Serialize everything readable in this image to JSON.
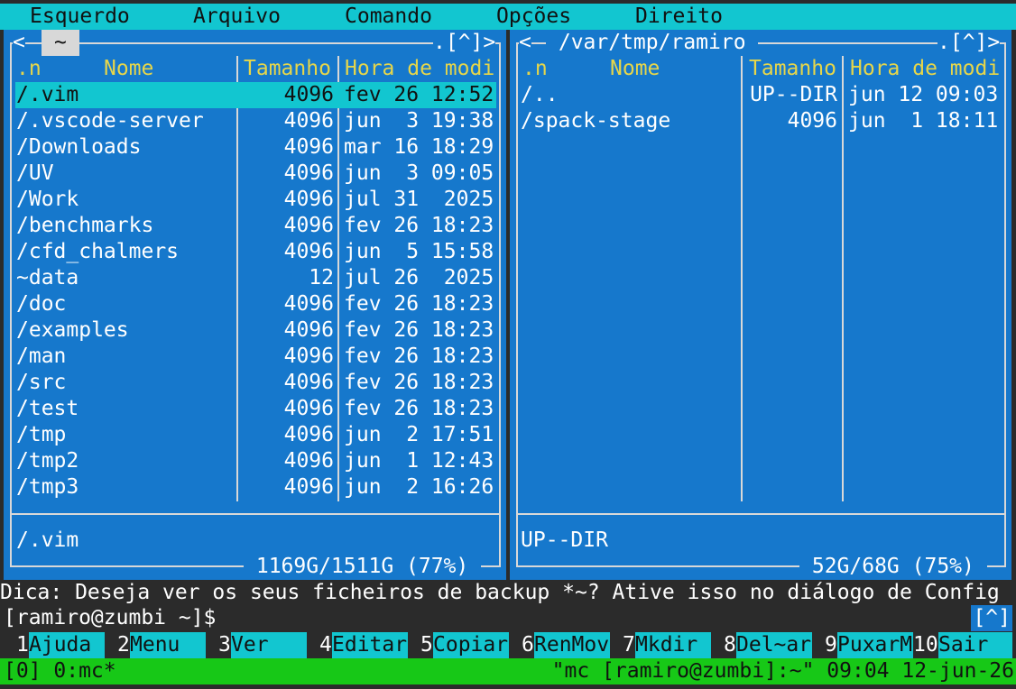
{
  "menubar": {
    "items": [
      "Esquerdo",
      "Arquivo",
      "Comando",
      "Opções",
      "Direito"
    ]
  },
  "left_panel": {
    "path": "~",
    "corner_left": "<",
    "corner_right": ".[^]>",
    "headers": {
      "name_sort": ".n",
      "name": "Nome",
      "size": "Tamanho",
      "time": "Hora de modi"
    },
    "rows": [
      {
        "name": "/.vim",
        "size": "4096",
        "time": "fev 26 12:52",
        "selected": true
      },
      {
        "name": "/.vscode-server",
        "size": "4096",
        "time": "jun  3 19:38"
      },
      {
        "name": "/Downloads",
        "size": "4096",
        "time": "mar 16 18:29"
      },
      {
        "name": "/UV",
        "size": "4096",
        "time": "jun  3 09:05"
      },
      {
        "name": "/Work",
        "size": "4096",
        "time": "jul 31  2025"
      },
      {
        "name": "/benchmarks",
        "size": "4096",
        "time": "fev 26 18:23"
      },
      {
        "name": "/cfd_chalmers",
        "size": "4096",
        "time": "jun  5 15:58"
      },
      {
        "name": "~data",
        "size": "12",
        "time": "jul 26  2025"
      },
      {
        "name": "/doc",
        "size": "4096",
        "time": "fev 26 18:23"
      },
      {
        "name": "/examples",
        "size": "4096",
        "time": "fev 26 18:23"
      },
      {
        "name": "/man",
        "size": "4096",
        "time": "fev 26 18:23"
      },
      {
        "name": "/src",
        "size": "4096",
        "time": "fev 26 18:23"
      },
      {
        "name": "/test",
        "size": "4096",
        "time": "fev 26 18:23"
      },
      {
        "name": "/tmp",
        "size": "4096",
        "time": "jun  2 17:51"
      },
      {
        "name": "/tmp2",
        "size": "4096",
        "time": "jun  1 12:43"
      },
      {
        "name": "/tmp3",
        "size": "4096",
        "time": "jun  2 16:26"
      }
    ],
    "mini_status": "/.vim",
    "disk": " 1169G/1511G (77%) "
  },
  "right_panel": {
    "path": " /var/tmp/ramiro ",
    "corner_left": "<",
    "corner_right": ".[^]>",
    "headers": {
      "name_sort": ".n",
      "name": "Nome",
      "size": "Tamanho",
      "time": "Hora de modi"
    },
    "rows": [
      {
        "name": "/..",
        "size": "UP--DIR",
        "time": "jun 12 09:03"
      },
      {
        "name": "/spack-stage",
        "size": "4096",
        "time": "jun  1 18:11"
      }
    ],
    "mini_status": "UP--DIR",
    "disk": " 52G/68G (75%) "
  },
  "hint": "Dica: Deseja ver os seus ficheiros de backup *~? Ative isso no diálogo de Config",
  "prompt": {
    "text": "[ramiro@zumbi ~]$",
    "mark": "[^]"
  },
  "fkeys": [
    {
      "num": "1",
      "label": "Ajuda"
    },
    {
      "num": "2",
      "label": "Menu"
    },
    {
      "num": "3",
      "label": "Ver"
    },
    {
      "num": "4",
      "label": "Editar"
    },
    {
      "num": "5",
      "label": "Copiar"
    },
    {
      "num": "6",
      "label": "RenMov"
    },
    {
      "num": "7",
      "label": "Mkdir"
    },
    {
      "num": "8",
      "label": "Del~ar"
    },
    {
      "num": "9",
      "label": "PuxarM"
    },
    {
      "num": "10",
      "label": "Sair"
    }
  ],
  "tmux": {
    "left": "[0] 0:mc*",
    "right": "\"mc [ramiro@zumbi]:~\" 09:04 12-jun-26"
  },
  "colors": {
    "panel": "#1678cc",
    "accent": "#12c6d0",
    "header": "#e6d64a",
    "status": "#17c817"
  }
}
